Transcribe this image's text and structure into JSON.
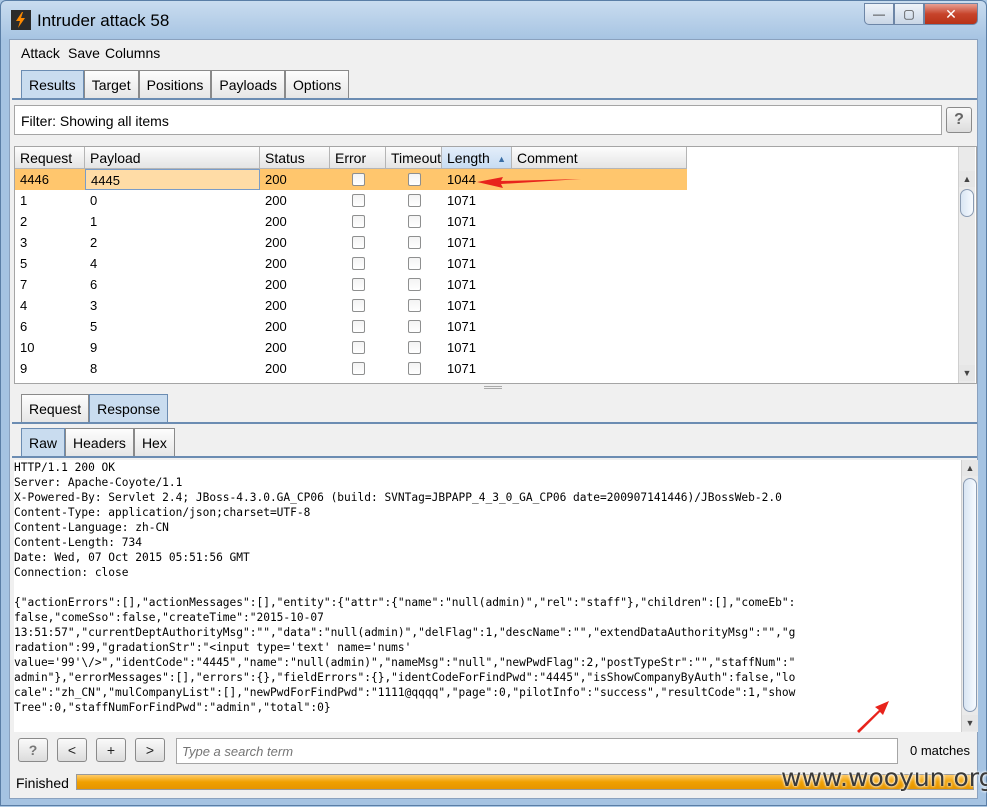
{
  "window": {
    "title": "Intruder attack 58",
    "min_glyph": "—",
    "max_glyph": "▢",
    "close_glyph": "✕"
  },
  "menu": [
    "Attack",
    "Save",
    "Columns"
  ],
  "top_tabs": [
    "Results",
    "Target",
    "Positions",
    "Payloads",
    "Options"
  ],
  "filter": {
    "text": "Filter: Showing all items",
    "help": "?"
  },
  "table": {
    "columns": [
      "Request",
      "Payload",
      "Status",
      "Error",
      "Timeout",
      "Length",
      "Comment"
    ],
    "sort_indicator": "▲",
    "rows": [
      {
        "request": "4446",
        "payload": "4445",
        "status": "200",
        "length": "1044",
        "selected": true
      },
      {
        "request": "1",
        "payload": "0",
        "status": "200",
        "length": "1071"
      },
      {
        "request": "2",
        "payload": "1",
        "status": "200",
        "length": "1071"
      },
      {
        "request": "3",
        "payload": "2",
        "status": "200",
        "length": "1071"
      },
      {
        "request": "5",
        "payload": "4",
        "status": "200",
        "length": "1071"
      },
      {
        "request": "7",
        "payload": "6",
        "status": "200",
        "length": "1071"
      },
      {
        "request": "4",
        "payload": "3",
        "status": "200",
        "length": "1071"
      },
      {
        "request": "6",
        "payload": "5",
        "status": "200",
        "length": "1071"
      },
      {
        "request": "10",
        "payload": "9",
        "status": "200",
        "length": "1071"
      },
      {
        "request": "9",
        "payload": "8",
        "status": "200",
        "length": "1071"
      }
    ]
  },
  "rr_tabs": [
    "Request",
    "Response"
  ],
  "view_tabs": [
    "Raw",
    "Headers",
    "Hex"
  ],
  "response_lines": [
    "HTTP/1.1 200 OK",
    "Server: Apache-Coyote/1.1",
    "X-Powered-By: Servlet 2.4; JBoss-4.3.0.GA_CP06 (build: SVNTag=JBPAPP_4_3_0_GA_CP06 date=200907141446)/JBossWeb-2.0",
    "Content-Type: application/json;charset=UTF-8",
    "Content-Language: zh-CN",
    "Content-Length: 734",
    "Date: Wed, 07 Oct 2015 05:51:56 GMT",
    "Connection: close",
    "",
    "{\"actionErrors\":[],\"actionMessages\":[],\"entity\":{\"attr\":{\"name\":\"null(admin)\",\"rel\":\"staff\"},\"children\":[],\"comeEb\":",
    "false,\"comeSso\":false,\"createTime\":\"2015-10-07",
    "13:51:57\",\"currentDeptAuthorityMsg\":\"\",\"data\":\"null(admin)\",\"delFlag\":1,\"descName\":\"\",\"extendDataAuthorityMsg\":\"\",\"g",
    "radation\":99,\"gradationStr\":\"<input type='text' name='nums'",
    "value='99'\\/>\",\"identCode\":\"4445\",\"name\":\"null(admin)\",\"nameMsg\":\"null\",\"newPwdFlag\":2,\"postTypeStr\":\"\",\"staffNum\":\"",
    "admin\"},\"errorMessages\":[],\"errors\":{},\"fieldErrors\":{},\"identCodeForFindPwd\":\"4445\",\"isShowCompanyByAuth\":false,\"lo",
    "cale\":\"zh_CN\",\"mulCompanyList\":[],\"newPwdForFindPwd\":\"1111@qqqq\",\"page\":0,\"pilotInfo\":\"success\",\"resultCode\":1,\"show",
    "Tree\":0,\"staffNumForFindPwd\":\"admin\",\"total\":0}"
  ],
  "search": {
    "help": "?",
    "prev": "<",
    "add": "+",
    "next": ">",
    "placeholder": "Type a search term",
    "matches": "0 matches"
  },
  "status": {
    "text": "Finished",
    "progress": 1.0
  },
  "watermark": "www.wooyun.org",
  "colors": {
    "selected_row": "#ffc66d",
    "progress": "#f0a000",
    "annotation_arrow": "#e8231c"
  }
}
